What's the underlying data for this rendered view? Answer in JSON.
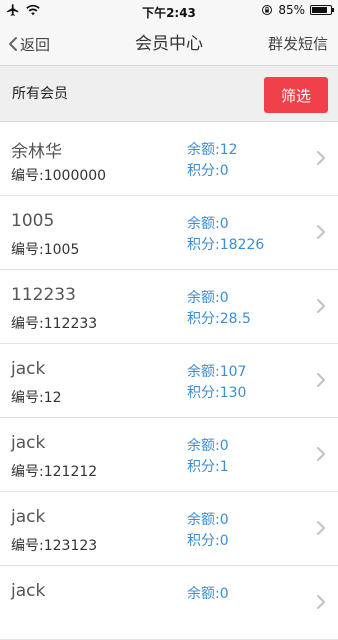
{
  "status_bar": {
    "time": "下午2:43",
    "battery": "85%",
    "battery_level": 0.85
  },
  "nav": {
    "back_label": "返回",
    "title": "会员中心",
    "action_label": "群发短信"
  },
  "filter": {
    "label": "所有会员",
    "button_label": "筛选"
  },
  "members": [
    {
      "name": "余林华",
      "id": "编号:1000000",
      "balance": "余额:12",
      "points": "积分:0"
    },
    {
      "name": "1005",
      "id": "编号:1005",
      "balance": "余额:0",
      "points": "积分:18226"
    },
    {
      "name": "112233",
      "id": "编号:112233",
      "balance": "余额:0",
      "points": "积分:28.5"
    },
    {
      "name": "jack",
      "id": "编号:12",
      "balance": "余额:107",
      "points": "积分:130"
    },
    {
      "name": "jack",
      "id": "编号:121212",
      "balance": "余额:0",
      "points": "积分:1"
    },
    {
      "name": "jack",
      "id": "编号:123123",
      "balance": "余额:0",
      "points": "积分:0"
    },
    {
      "name": "jack",
      "id": "",
      "balance": "余额:0",
      "points": ""
    }
  ],
  "colors": {
    "accent_red": "#f0414a",
    "link_blue": "#3b8ed6"
  },
  "icons": {
    "airplane": "airplane-icon",
    "wifi": "wifi-icon",
    "rotation_lock": "rotation-lock-icon",
    "battery": "battery-icon",
    "back": "chevron-left-icon",
    "row": "chevron-right-icon"
  }
}
